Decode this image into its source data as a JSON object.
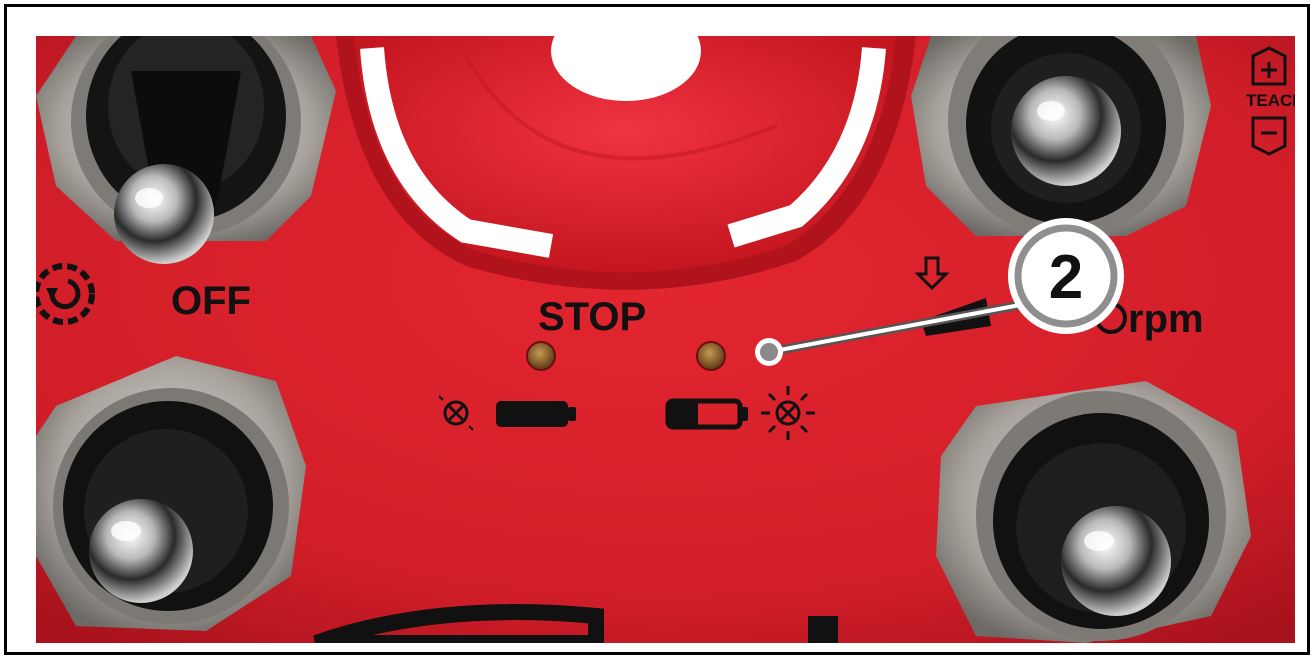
{
  "panel": {
    "label_off": "OFF",
    "label_stop": "STOP",
    "label_rpm": "rpm",
    "label_teach": "TEACH",
    "icons": [
      "gear-rotate-icon",
      "light-off-icon",
      "battery-full-icon",
      "battery-low-icon",
      "light-on-icon",
      "arrow-down-icon",
      "teach-plus-icon",
      "teach-minus-icon"
    ],
    "colors": {
      "panel": "#d5202c",
      "panel_dark": "#a9141c",
      "emergency_button": "#e8232f",
      "led": "#8a5a1e"
    }
  },
  "callout": {
    "number": "2"
  }
}
